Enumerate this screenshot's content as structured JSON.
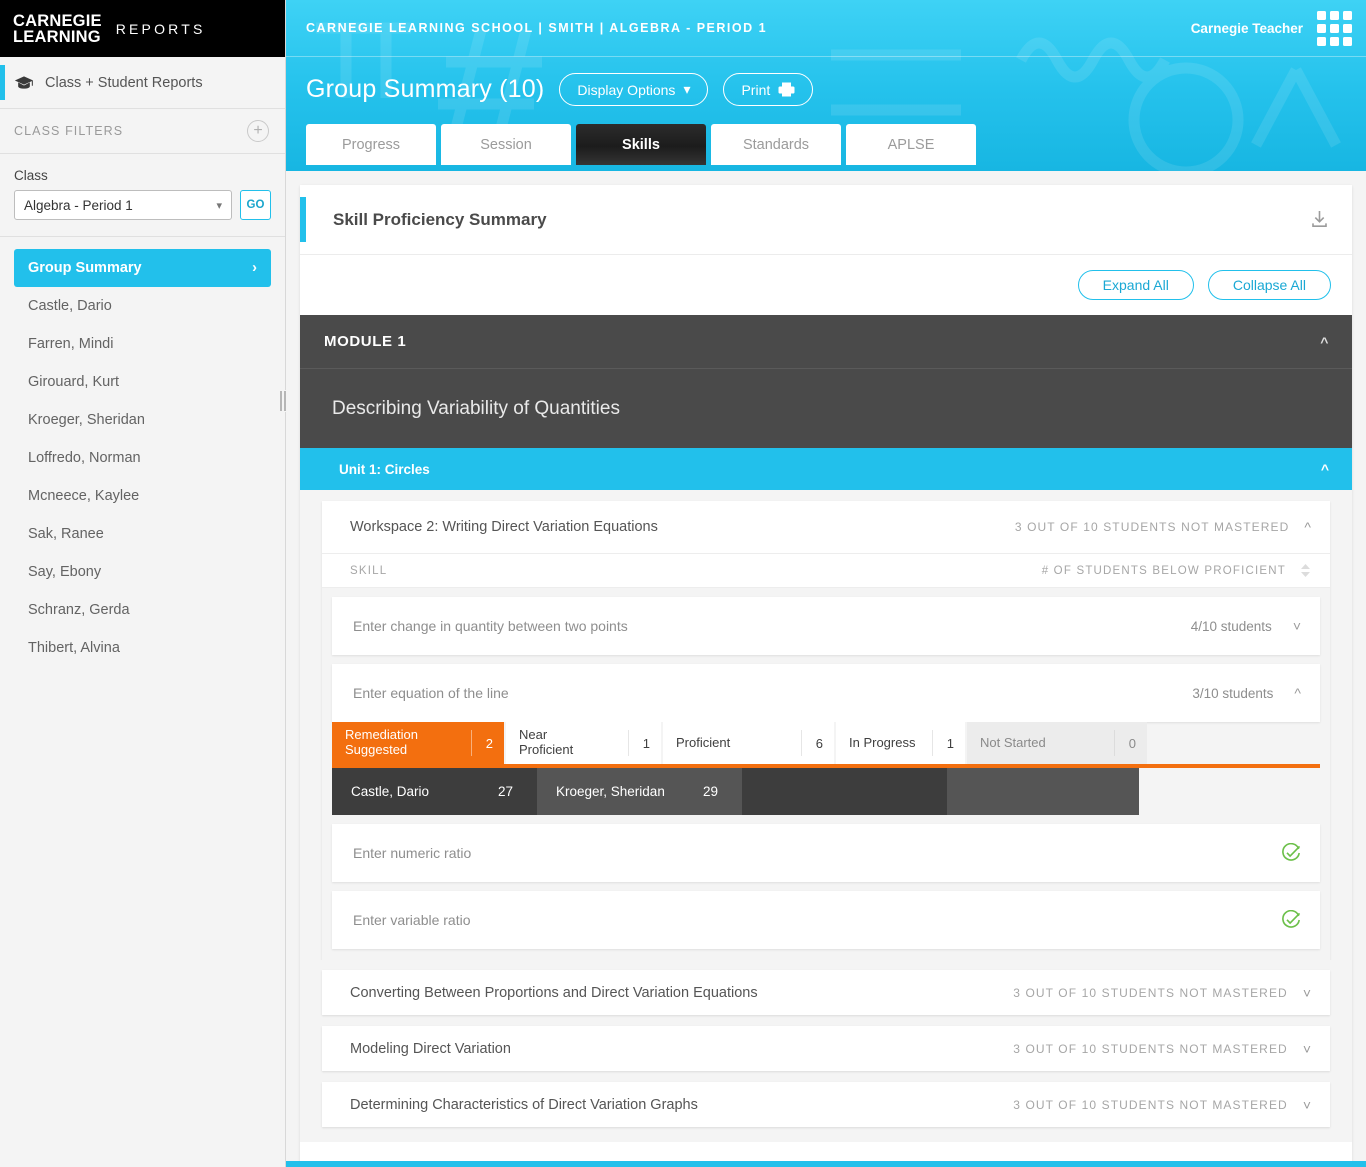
{
  "brand": {
    "logo_line1": "CARNEGIE",
    "logo_line2": "LEARNING",
    "logo_suffix": "REPORTS",
    "accent_cyan": "#22c0eb",
    "accent_orange": "#f36f0f",
    "accent_green": "#6cc04a",
    "dark": "#4a4a4a"
  },
  "sidebar": {
    "header_label": "Class + Student Reports",
    "header_icon": "graduation-cap-icon",
    "filters_title": "CLASS FILTERS",
    "add_icon": "plus-icon",
    "class_label": "Class",
    "class_value": "Algebra - Period 1",
    "go_label": "GO",
    "group_summary_label": "Group Summary",
    "students": [
      "Castle, Dario",
      "Farren, Mindi",
      "Girouard, Kurt",
      "Kroeger, Sheridan",
      "Loffredo, Norman",
      "Mcneece, Kaylee",
      " Sak, Ranee",
      "Say, Ebony",
      "Schranz, Gerda",
      "Thibert, Alvina"
    ]
  },
  "header": {
    "breadcrumb": "CARNEGIE LEARNING SCHOOL | SMITH | ALGEBRA - PERIOD 1",
    "user": "Carnegie Teacher",
    "apps_icon": "grid-apps-icon",
    "page_title": "Group Summary (10)",
    "display_options_label": "Display Options",
    "print_label": "Print",
    "print_icon": "printer-icon",
    "tabs": [
      {
        "label": "Progress",
        "active": false
      },
      {
        "label": "Session",
        "active": false
      },
      {
        "label": "Skills",
        "active": true
      },
      {
        "label": "Standards",
        "active": false
      },
      {
        "label": "APLSE",
        "active": false
      }
    ]
  },
  "panel": {
    "title": "Skill Proficiency Summary",
    "download_icon": "download-icon",
    "expand_all_label": "Expand All",
    "collapse_all_label": "Collapse All"
  },
  "module": {
    "title": "MODULE 1",
    "subtitle": "Describing Variability of Quantities",
    "unit_title": "Unit 1: Circles",
    "collapse_icon": "chevron-up-icon"
  },
  "workspace": {
    "name": "Workspace 2: Writing Direct Variation Equations",
    "status": "3 OUT OF 10 STUDENTS NOT MASTERED",
    "toggle_icon": "chevron-up-icon",
    "col_skill": "SKILL",
    "col_count": "# OF STUDENTS BELOW PROFICIENT",
    "sort_icon": "sort-arrows-icon"
  },
  "skills": [
    {
      "name": "Enter change in quantity between two points",
      "count": "4/10 students",
      "expanded": false,
      "icon": "chevron-down-icon"
    },
    {
      "name": "Enter equation of the line",
      "count": "3/10 students",
      "expanded": true,
      "icon": "chevron-up-icon"
    },
    {
      "name": "Enter numeric ratio",
      "count": "",
      "expanded": false,
      "icon": "check-circle-icon"
    },
    {
      "name": "Enter variable ratio",
      "count": "",
      "expanded": false,
      "icon": "check-circle-icon"
    }
  ],
  "buckets": [
    {
      "label": "Remediation Suggested",
      "label_l1": "Remediation",
      "label_l2": "Suggested",
      "value": "2",
      "kind": "remediation"
    },
    {
      "label": "Near Proficient",
      "label_l1": "Near",
      "label_l2": "Proficient",
      "value": "1",
      "kind": "near"
    },
    {
      "label": "Proficient",
      "label_l1": "Proficient",
      "label_l2": "",
      "value": "6",
      "kind": "proficient"
    },
    {
      "label": "In Progress",
      "label_l1": "In Progress",
      "label_l2": "",
      "value": "1",
      "kind": "inprogress"
    },
    {
      "label": "Not Started",
      "label_l1": "Not Started",
      "label_l2": "",
      "value": "0",
      "kind": "notstarted"
    }
  ],
  "bucket_students": [
    {
      "name": "Castle, Dario",
      "score": "27"
    },
    {
      "name": "Kroeger, Sheridan",
      "score": "29"
    }
  ],
  "collapsed_workspaces": [
    {
      "name": "Converting Between Proportions and Direct Variation Equations",
      "status": "3 OUT OF 10 STUDENTS NOT MASTERED",
      "icon": "chevron-down-icon"
    },
    {
      "name": "Modeling Direct Variation",
      "status": "3 OUT OF 10 STUDENTS NOT MASTERED",
      "icon": "chevron-down-icon"
    },
    {
      "name": "Determining Characteristics of Direct Variation Graphs",
      "status": "3 OUT OF 10 STUDENTS NOT MASTERED",
      "icon": "chevron-down-icon"
    }
  ]
}
